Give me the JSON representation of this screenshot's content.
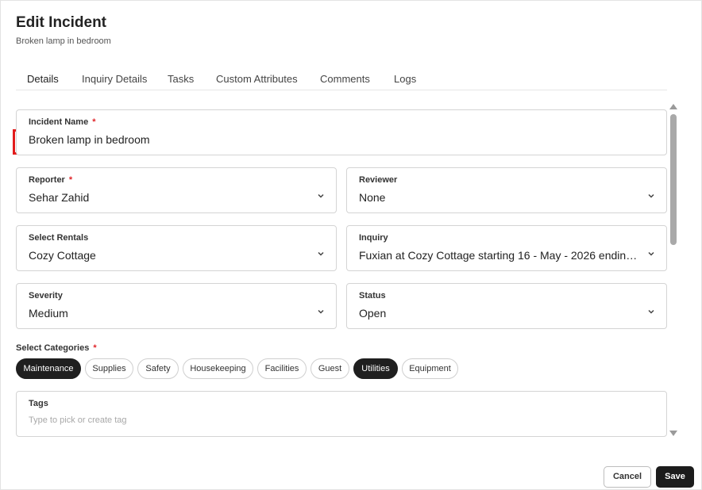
{
  "header": {
    "title": "Edit Incident",
    "subtitle": "Broken lamp in bedroom"
  },
  "tabs": [
    {
      "label": "Details",
      "active": true
    },
    {
      "label": "Inquiry Details",
      "active": false
    },
    {
      "label": "Tasks",
      "active": false
    },
    {
      "label": "Custom Attributes",
      "active": false
    },
    {
      "label": "Comments",
      "active": false
    },
    {
      "label": "Logs",
      "active": false
    }
  ],
  "form": {
    "incident_name": {
      "label": "Incident Name",
      "required_mark": "*",
      "value": "Broken lamp in bedroom"
    },
    "reporter": {
      "label": "Reporter",
      "required_mark": "*",
      "value": "Sehar Zahid",
      "icon": "chevron-down-icon"
    },
    "reviewer": {
      "label": "Reviewer",
      "value": "None",
      "icon": "chevron-down-icon"
    },
    "select_rentals": {
      "label": "Select Rentals",
      "value": "Cozy Cottage",
      "icon": "chevron-down-icon"
    },
    "inquiry": {
      "label": "Inquiry",
      "value": "Fuxian at Cozy Cottage starting 16 - May - 2026 ending ...",
      "icon": "chevron-down-icon"
    },
    "severity": {
      "label": "Severity",
      "value": "Medium",
      "icon": "chevron-down-icon"
    },
    "status": {
      "label": "Status",
      "value": "Open",
      "icon": "chevron-down-icon"
    },
    "categories": {
      "label": "Select Categories",
      "required_mark": "*",
      "items": [
        {
          "label": "Maintenance",
          "selected": true
        },
        {
          "label": "Supplies",
          "selected": false
        },
        {
          "label": "Safety",
          "selected": false
        },
        {
          "label": "Housekeeping",
          "selected": false
        },
        {
          "label": "Facilities",
          "selected": false
        },
        {
          "label": "Guest",
          "selected": false
        },
        {
          "label": "Utilities",
          "selected": true
        },
        {
          "label": "Equipment",
          "selected": false
        }
      ]
    },
    "tags": {
      "label": "Tags",
      "placeholder": "Type to pick or create tag"
    }
  },
  "footer": {
    "cancel_label": "Cancel",
    "save_label": "Save"
  },
  "colors": {
    "accent_dark": "#1f1f1f",
    "required": "#e0252a",
    "highlight_box": "#e21b1b"
  }
}
